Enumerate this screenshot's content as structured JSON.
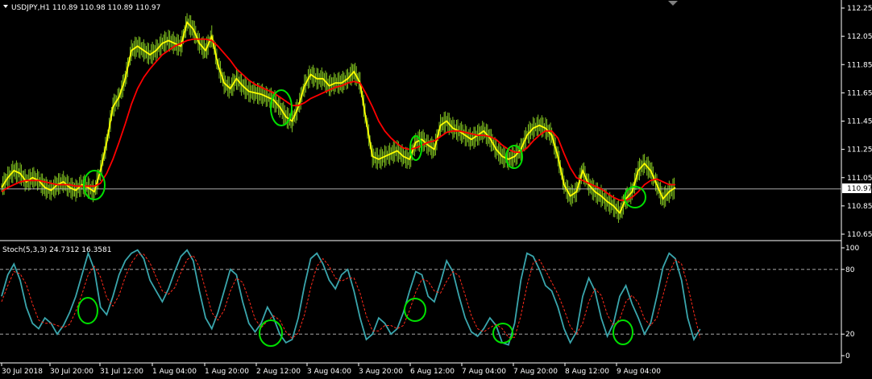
{
  "colors": {
    "background": "#000000",
    "frame": "#ffffff",
    "price_bars": "#7fbf1f",
    "fast_line": "#ffff00",
    "slow_line": "#ff0000",
    "current_price_line": "#c0c0c0",
    "stoch_main": "#3aa6ad",
    "stoch_signal": "#ff2a1a",
    "markers": "#00e000",
    "levels": "#c0c0c0"
  },
  "main_panel": {
    "symbol_header": "USDJPY,H1  110.89 110.98 110.89 110.97",
    "y_ticks": [
      "112.25",
      "112.05",
      "111.85",
      "111.65",
      "111.45",
      "111.25",
      "111.05",
      "110.85",
      "110.65"
    ],
    "current_price_label": "110.97"
  },
  "stoch_panel": {
    "header": "Stoch(5,3,3) 24.7312 16.3581",
    "y_ticks": [
      "100",
      "80",
      "20",
      "0"
    ]
  },
  "x_ticks": [
    "30 Jul 2018",
    "30 Jul 20:00",
    "31 Jul 12:00",
    "1 Aug 04:00",
    "1 Aug 20:00",
    "2 Aug 12:00",
    "3 Aug 04:00",
    "3 Aug 20:00",
    "6 Aug 12:00",
    "7 Aug 04:00",
    "7 Aug 20:00",
    "8 Aug 12:00",
    "9 Aug 04:00"
  ],
  "chart_data": [
    {
      "type": "line",
      "title": "USDJPY,H1",
      "x_unit": "hourly bars",
      "ylim": [
        110.6,
        112.3
      ],
      "series": [
        {
          "values": [
            110.98,
            111.05,
            111.1,
            111.08,
            111.02,
            111.05,
            111.03,
            110.98,
            110.96,
            111.0,
            111.02,
            110.98,
            110.96,
            111.0,
            110.98,
            110.95,
            111.1,
            111.3,
            111.55,
            111.62,
            111.75,
            111.95,
            111.98,
            111.95,
            111.92,
            111.95,
            112.0,
            112.02,
            112.0,
            111.98,
            112.15,
            112.1,
            112.0,
            111.95,
            112.05,
            111.85,
            111.72,
            111.68,
            111.75,
            111.7,
            111.66,
            111.65,
            111.64,
            111.62,
            111.6,
            111.55,
            111.48,
            111.45,
            111.55,
            111.7,
            111.78,
            111.75,
            111.75,
            111.7,
            111.72,
            111.72,
            111.75,
            111.8,
            111.72,
            111.45,
            111.2,
            111.18,
            111.2,
            111.22,
            111.24,
            111.2,
            111.18,
            111.3,
            111.32,
            111.28,
            111.25,
            111.42,
            111.45,
            111.4,
            111.38,
            111.35,
            111.32,
            111.35,
            111.38,
            111.33,
            111.25,
            111.2,
            111.18,
            111.2,
            111.25,
            111.35,
            111.4,
            111.42,
            111.4,
            111.35,
            111.2,
            111.0,
            110.92,
            110.95,
            111.1,
            111.0,
            110.95,
            110.92,
            110.88,
            110.85,
            110.8,
            110.9,
            110.95,
            111.1,
            111.15,
            111.1,
            111.0,
            110.9,
            110.95,
            110.98
          ]
        },
        {
          "values": [
            110.95,
            110.98,
            111.0,
            111.02,
            111.03,
            111.03,
            111.03,
            111.02,
            111.01,
            111.0,
            111.0,
            111.0,
            110.99,
            110.99,
            110.99,
            110.99,
            111.01,
            111.08,
            111.18,
            111.3,
            111.43,
            111.57,
            111.68,
            111.76,
            111.82,
            111.87,
            111.92,
            111.95,
            111.98,
            112.0,
            112.02,
            112.03,
            112.03,
            112.03,
            112.02,
            111.98,
            111.93,
            111.88,
            111.82,
            111.78,
            111.74,
            111.71,
            111.69,
            111.67,
            111.65,
            111.62,
            111.59,
            111.56,
            111.56,
            111.58,
            111.61,
            111.63,
            111.65,
            111.67,
            111.69,
            111.7,
            111.72,
            111.73,
            111.72,
            111.64,
            111.55,
            111.45,
            111.38,
            111.33,
            111.29,
            111.26,
            111.25,
            111.26,
            111.28,
            111.3,
            111.31,
            111.34,
            111.37,
            111.38,
            111.38,
            111.37,
            111.36,
            111.35,
            111.35,
            111.34,
            111.32,
            111.28,
            111.25,
            111.23,
            111.23,
            111.26,
            111.31,
            111.35,
            111.38,
            111.38,
            111.33,
            111.22,
            111.12,
            111.05,
            111.03,
            111.01,
            110.99,
            110.97,
            110.94,
            110.91,
            110.89,
            110.89,
            110.91,
            110.95,
            111.0,
            111.03,
            111.04,
            111.02,
            111.0,
            111.0
          ]
        }
      ]
    },
    {
      "type": "line",
      "title": "Stoch(5,3,3) 24.7312 16.3581",
      "ylim": [
        0,
        100
      ],
      "levels": [
        20,
        80
      ],
      "series": [
        {
          "values": [
            55,
            75,
            85,
            70,
            45,
            30,
            25,
            35,
            30,
            20,
            28,
            40,
            55,
            75,
            95,
            80,
            45,
            38,
            55,
            75,
            88,
            95,
            98,
            90,
            70,
            60,
            50,
            62,
            78,
            92,
            98,
            88,
            60,
            35,
            25,
            40,
            60,
            80,
            75,
            50,
            30,
            22,
            30,
            45,
            35,
            20,
            12,
            15,
            35,
            65,
            90,
            95,
            85,
            70,
            62,
            75,
            80,
            60,
            35,
            15,
            20,
            35,
            30,
            20,
            25,
            40,
            60,
            78,
            75,
            55,
            50,
            68,
            88,
            78,
            55,
            35,
            22,
            18,
            25,
            35,
            28,
            12,
            10,
            30,
            70,
            95,
            92,
            80,
            65,
            60,
            45,
            25,
            12,
            22,
            55,
            72,
            60,
            35,
            18,
            30,
            55,
            65,
            48,
            35,
            20,
            30,
            55,
            82,
            95,
            90,
            70,
            35,
            15,
            24.73
          ]
        },
        {
          "values": [
            50,
            65,
            78,
            76,
            66,
            48,
            33,
            30,
            30,
            28,
            26,
            29,
            41,
            57,
            75,
            83,
            73,
            54,
            46,
            56,
            73,
            86,
            94,
            94,
            86,
            73,
            60,
            57,
            63,
            77,
            89,
            93,
            82,
            61,
            40,
            33,
            42,
            60,
            72,
            68,
            52,
            34,
            26,
            32,
            37,
            33,
            22,
            16,
            21,
            38,
            63,
            83,
            90,
            83,
            72,
            69,
            72,
            72,
            58,
            37,
            23,
            23,
            28,
            28,
            25,
            28,
            42,
            59,
            71,
            69,
            60,
            58,
            69,
            78,
            74,
            56,
            37,
            25,
            22,
            26,
            29,
            25,
            17,
            17,
            37,
            65,
            86,
            89,
            79,
            68,
            57,
            43,
            27,
            20,
            30,
            50,
            62,
            56,
            38,
            28,
            34,
            50,
            56,
            49,
            34,
            28,
            35,
            56,
            77,
            89,
            85,
            65,
            40,
            16.36
          ]
        }
      ]
    }
  ]
}
